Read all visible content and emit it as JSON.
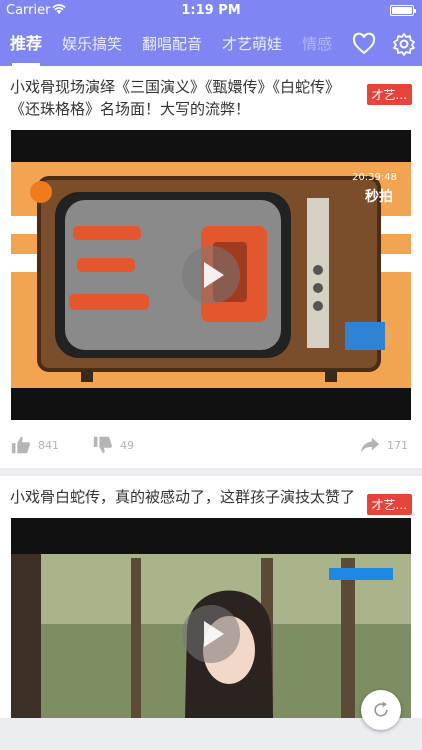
{
  "status": {
    "carrier": "Carrier",
    "time": "1:19 PM"
  },
  "nav": {
    "tabs": [
      "推荐",
      "娱乐搞笑",
      "翻唱配音",
      "才艺萌娃",
      "情感"
    ],
    "icons": [
      "heart-icon",
      "gear-icon"
    ]
  },
  "posts": [
    {
      "title": "小戏骨现场演绎《三国演义》《甄嬛传》《白蛇传》《还珠格格》名场面！大写的流弊！",
      "tag": "才艺...",
      "video_overlay": "秒拍",
      "video_time": "20:39:48",
      "likes": "841",
      "dislikes": "49",
      "shares": "171"
    },
    {
      "title": "小戏骨白蛇传，真的被感动了，这群孩子演技太赞了",
      "tag": "才艺..."
    }
  ],
  "colors": {
    "accent": "#7f86f3",
    "tag": "#e8433b"
  }
}
